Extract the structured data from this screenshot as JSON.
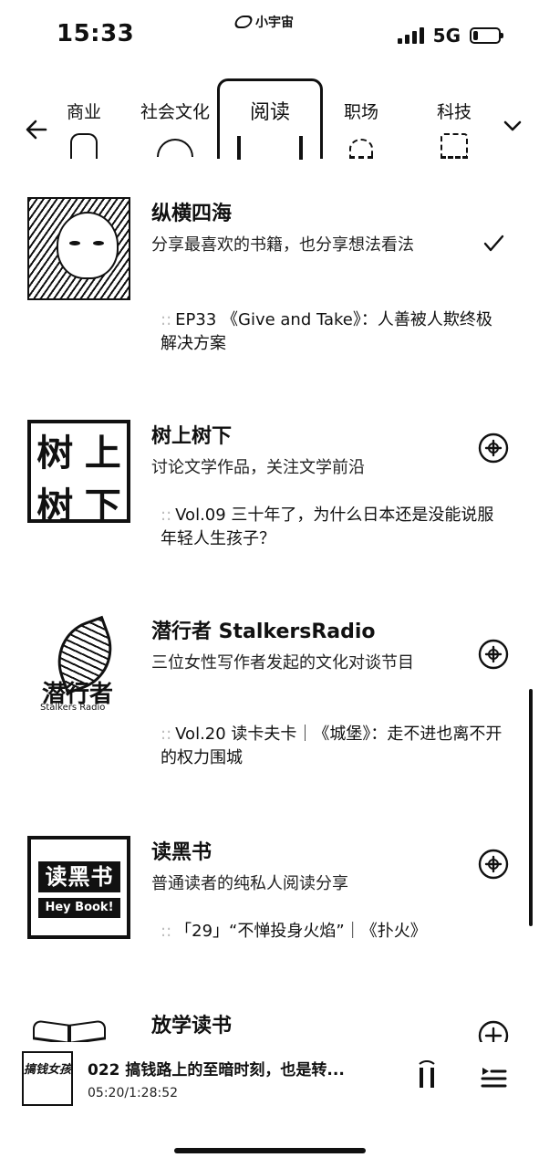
{
  "status_bar": {
    "time": "15:33",
    "logo_text": "小宇宙",
    "network": "5G"
  },
  "tabs": [
    {
      "label": "商业",
      "active": false
    },
    {
      "label": "社会文化",
      "active": false
    },
    {
      "label": "阅读",
      "active": true
    },
    {
      "label": "职场",
      "active": false
    },
    {
      "label": "科技",
      "active": false
    }
  ],
  "podcasts": [
    {
      "title": "纵横四海",
      "description": "分享最喜欢的书籍，也分享想法看法",
      "episode": "EP33 《Give and Take》：人善被人欺终极解决方案",
      "subscribed": true,
      "cover_icon": "portrait-illustration"
    },
    {
      "title": "树上树下",
      "description": "讨论文学作品，关注文学前沿",
      "episode": "Vol.09 三十年了，为什么日本还是没能说服年轻人生孩子？",
      "subscribed": false,
      "cover_text": [
        "树",
        "上",
        "树",
        "下"
      ]
    },
    {
      "title": "潜行者 StalkersRadio",
      "description": "三位女性写作者发起的文化对谈节目",
      "episode": "Vol.20 读卡夫卡｜《城堡》：走不进也离不开的权力围城",
      "subscribed": false,
      "cover_text_cn": "潜行者",
      "cover_text_en": "Stalkers Radio"
    },
    {
      "title": "读黑书",
      "description": "普通读者的纯私人阅读分享",
      "episode": "「29」“不惮投身火焰”｜《扑火》",
      "subscribed": false,
      "cover_text_cn": "读黑书",
      "cover_text_en": "Hey Book!"
    },
    {
      "title": "放学读书",
      "subscribed": false,
      "cover_icon": "open-book"
    }
  ],
  "player": {
    "title": "022 搞钱路上的至暗时刻，也是转...",
    "time": "05:20/1:28:52",
    "cover_text": "搞钱女孩"
  },
  "colors": {
    "foreground": "#111111",
    "background": "#ffffff"
  }
}
